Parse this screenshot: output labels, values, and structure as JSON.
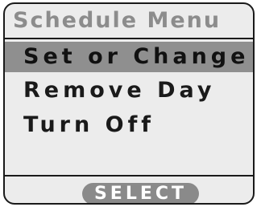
{
  "screen": {
    "title": "Schedule Menu"
  },
  "menu": {
    "items": [
      {
        "label": "Set or Change",
        "selected": true
      },
      {
        "label": "Remove Day",
        "selected": false
      },
      {
        "label": "Turn Off",
        "selected": false
      }
    ]
  },
  "softkey": {
    "select_label": "SELECT"
  }
}
